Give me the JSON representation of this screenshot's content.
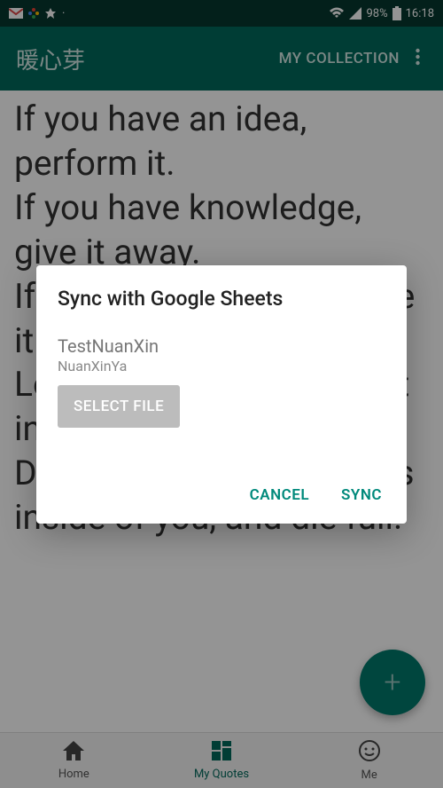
{
  "statusbar": {
    "battery_pct": "98%",
    "time": "16:18"
  },
  "appbar": {
    "title": "暖心芽",
    "action": "MY COLLECTION"
  },
  "content": {
    "quote": "If you have an idea, perform it.\nIf you have knowledge, give it away.\nIf you have a goal, achieve it.\nLove and be open about it inside.\nDo not keep the goodness inside of you, and die full."
  },
  "dialog": {
    "title": "Sync with Google Sheets",
    "file_primary": "TestNuanXin",
    "file_secondary": "NuanXinYa",
    "select_file": "SELECT FILE",
    "cancel": "CANCEL",
    "sync": "SYNC"
  },
  "bottomnav": {
    "home": "Home",
    "myquotes": "My Quotes",
    "me": "Me"
  },
  "fab": {
    "plus": "+"
  }
}
